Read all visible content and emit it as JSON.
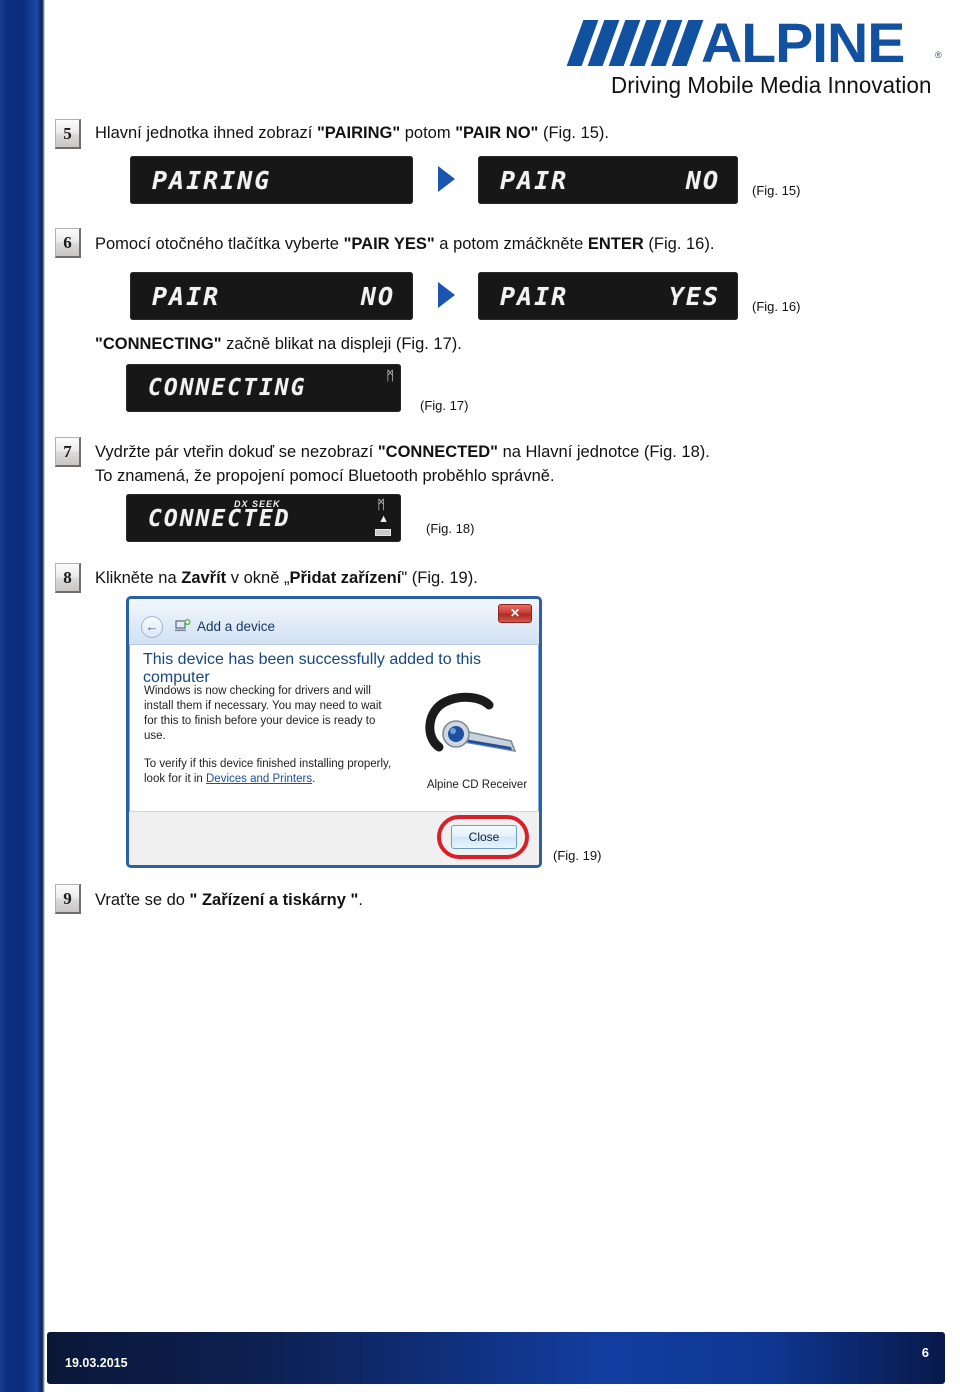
{
  "brand": {
    "name": "ALPINE",
    "tagline": "Driving Mobile Media Innovation",
    "registered_mark": "®",
    "logo_color": "#12519f"
  },
  "steps": [
    {
      "number": "5",
      "text_html": "Hlavní jednotka ihned zobrazí <b>\"PAIRING\"</b> potom <b>\"PAIR NO\"</b> (Fig. 15).",
      "plain": "Hlavní jednotka ihned zobrazí \"PAIRING\" potom \"PAIR NO\" (Fig. 15)."
    },
    {
      "number": "6",
      "text_html": "Pomocí otočného tlačítka vyberte <b>\"PAIR YES\"</b> a potom zmáčkněte <b>ENTER</b> (Fig. 16).",
      "plain": "Pomocí otočného tlačítka vyberte \"PAIR YES\" a potom zmáčkněte ENTER (Fig. 16)."
    },
    {
      "number": "7",
      "line1_html": "Vydržte pár vteřin dokuď se nezobrazí <b>\"CONNECTED\"</b> na Hlavní jednotce (Fig. 18).",
      "line2_html": "To znamená, že propojení pomocí Bluetooth proběhlo správně.",
      "plain1": "Vydržte pár vteřin dokuď se nezobrazí \"CONNECTED\" na Hlavní jednotce (Fig. 18).",
      "plain2": "To znamená, že propojení pomocí Bluetooth proběhlo správně."
    },
    {
      "number": "8",
      "text_html": "Klikněte na <b>Zavřít</b> v okně „<b>Přidat zařízení</b>\" (Fig. 19).",
      "plain": "Klikněte na Zavřít v okně „Přidat zařízení\" (Fig. 19)."
    },
    {
      "number": "9",
      "text_html": "Vraťte se do <b>\" Zařízení a tiskárny \"</b>.",
      "plain": "Vraťte se do \" Zařízení a tiskárny \"."
    }
  ],
  "connecting_note": {
    "text_html": "<b>\"CONNECTING\"</b> začně blikat na displeji (Fig. 17).",
    "plain": "\"CONNECTING\" začně blikat na displeji (Fig. 17)."
  },
  "displays": {
    "pairing": "PAIRING",
    "pair_label": "PAIR",
    "pair_no": "NO",
    "pair_yes": "YES",
    "connecting": "CONNECTING",
    "connected": "CONNECTED",
    "dx_seek": "DX SEEK",
    "bluetooth_glyph": "ᛗ"
  },
  "fig_labels": {
    "fig15": "(Fig. 15)",
    "fig16": "(Fig. 16)",
    "fig17": "(Fig. 17)",
    "fig18": "(Fig. 18)",
    "fig19": "(Fig. 19)"
  },
  "dialog": {
    "title": "Add a device",
    "back_glyph": "←",
    "close_glyph": "✕",
    "heading": "This device has been successfully added to this computer",
    "paragraph1": "Windows is now checking for drivers and will install them if necessary. You may need to wait for this to finish before your device is ready to use.",
    "paragraph2_prefix": "To verify if this device finished installing properly, look for it in ",
    "link": "Devices and Printers",
    "paragraph2_suffix": ".",
    "device_name": "Alpine CD Receiver",
    "close_button": "Close",
    "highlight_color": "#d91f28"
  },
  "footer": {
    "date": "19.03.2015",
    "page": "6"
  }
}
